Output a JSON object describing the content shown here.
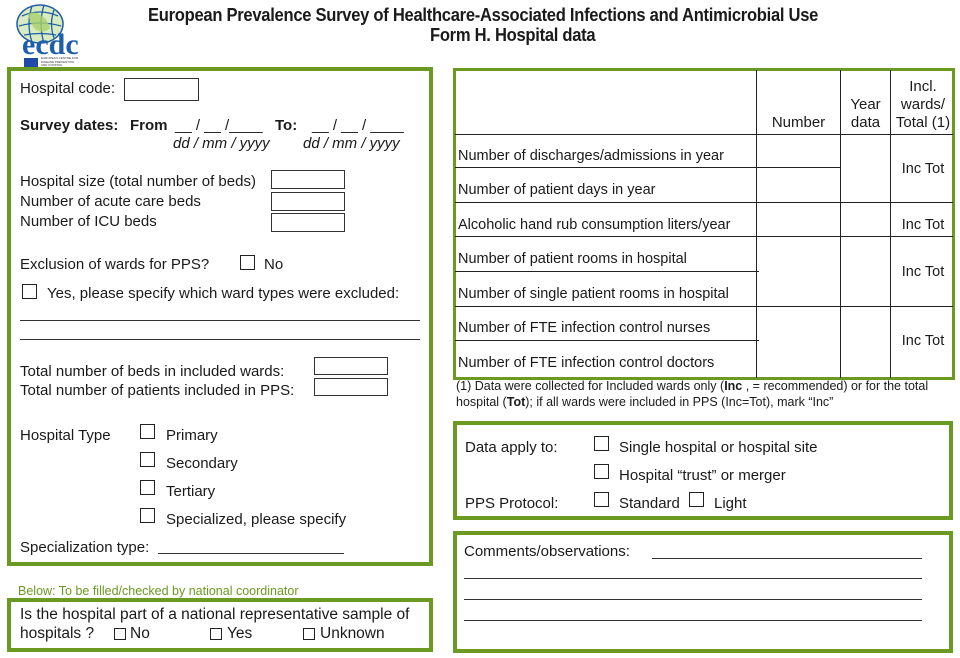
{
  "header": {
    "title_line1": "European Prevalence Survey of Healthcare-Associated Infections and Antimicrobial Use",
    "title_line2": "Form H. Hospital data",
    "logo": {
      "text": "ecdc",
      "subtext": "EUROPEAN CENTRE FOR DISEASE PREVENTION AND CONTROL"
    }
  },
  "colors": {
    "accent_green": "#6b9a22",
    "note_green": "#6b9a22",
    "logo_blue": "#1f5ea8"
  },
  "hospital_info": {
    "hospital_code_label": "Hospital code:",
    "hospital_code_value": "",
    "survey_dates_label": "Survey dates:",
    "from_label": "From",
    "from_value": "__ / __ /____",
    "to_label": "To:",
    "to_value": "__ / __  /  ____",
    "date_format": "dd / mm / yyyy",
    "hospital_size_label": "Hospital size (total number of beds)",
    "acute_beds_label": "Number of acute care beds",
    "icu_beds_label": "Number of ICU beds",
    "exclusion_label": "Exclusion of wards for PPS?",
    "exclusion_no": "No",
    "exclusion_yes": "Yes, please specify which ward types were excluded:",
    "beds_included_label": "Total number of beds in included wards:",
    "patients_included_label": "Total number of patients included in PPS:"
  },
  "hospital_type": {
    "label": "Hospital Type",
    "options": [
      "Primary",
      "Secondary",
      "Tertiary",
      "Specialized, please specify"
    ],
    "specialization_label": "Specialization type:"
  },
  "national_coordinator": {
    "note": "Below: To be filled/checked by national coordinator",
    "question_line1": "Is the hospital part of a national representative sample of",
    "question_line2": "hospitals ?",
    "options": [
      "No",
      "Yes",
      "Unknown"
    ]
  },
  "data_table": {
    "columns": [
      "",
      "Number",
      "Year data",
      "Incl. wards/ Total (1)"
    ],
    "header_year_line1": "Year",
    "header_year_line2": "data",
    "header_incl_line1": "Incl.",
    "header_incl_line2": "wards/",
    "header_incl_line3": "Total (1)",
    "rows": [
      "Number of discharges/admissions in year",
      "Number of patient days in year",
      "Alcoholic hand rub consumption liters/year",
      "Number of patient rooms in hospital",
      "Number of single patient rooms in hospital",
      "Number of FTE infection control nurses",
      "Number of FTE infection control doctors"
    ],
    "inc_tot_label": "Inc  Tot",
    "footnote_line1_a": "(1) Data were collected for Included wards only (",
    "footnote_inc": "Inc",
    "footnote_line1_b": " , = recommended) or for the total",
    "footnote_line2_a": "hospital (",
    "footnote_tot": "Tot",
    "footnote_line2_b": "); if all wards were included in PPS (Inc=Tot), mark “Inc”"
  },
  "data_apply": {
    "label": "Data apply to:",
    "options": [
      "Single hospital or hospital site",
      "Hospital “trust” or merger"
    ],
    "protocol_label": "PPS Protocol:",
    "protocol_options": [
      "Standard",
      "Light"
    ]
  },
  "comments": {
    "label": "Comments/observations:",
    "value": ""
  }
}
